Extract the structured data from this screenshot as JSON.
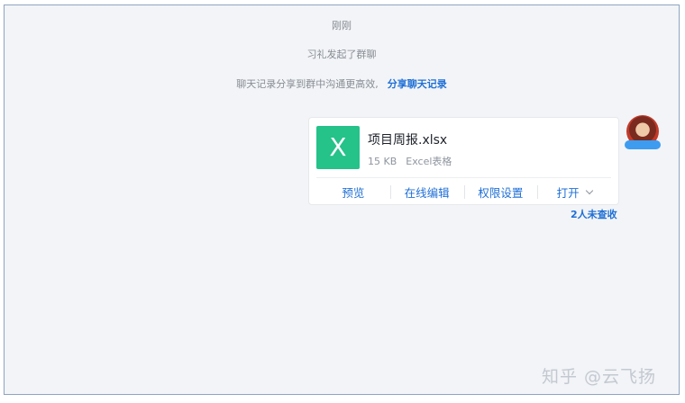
{
  "chat": {
    "timestamp": "刚刚",
    "group_created": "习礼发起了群聊",
    "share_hint": "聊天记录分享到群中沟通更高效,",
    "share_link": "分享聊天记录"
  },
  "file_card": {
    "icon_letter": "X",
    "icon_color": "#25c28a",
    "file_name": "项目周报.xlsx",
    "file_size": "15 KB",
    "file_type": "Excel表格",
    "actions": {
      "preview": "预览",
      "online_edit": "在线编辑",
      "permissions": "权限设置",
      "open": "打开"
    },
    "unread_status": "2人未查收"
  },
  "watermark": "知乎 @云飞扬",
  "colors": {
    "link": "#1f6fd6",
    "background": "#f2f4f7",
    "card": "#ffffff"
  }
}
